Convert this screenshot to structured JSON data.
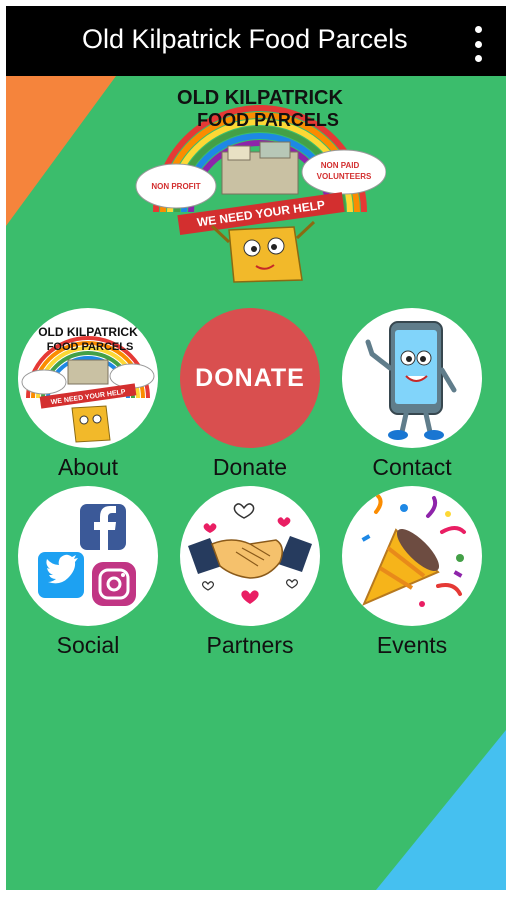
{
  "appbar": {
    "title": "Old Kilpatrick Food Parcels",
    "menu_icon": "overflow-menu-icon"
  },
  "logo": {
    "title_line1": "OLD KILPATRICK",
    "title_line2": "FOOD PARCELS",
    "non_profit": "NON PROFIT",
    "non_paid_line1": "NON PAID",
    "non_paid_line2": "VOLUNTEERS",
    "banner": "WE NEED YOUR HELP"
  },
  "tiles": [
    {
      "label": "About",
      "icon": "food-parcels-logo-icon"
    },
    {
      "label": "Donate",
      "icon": "donate-icon",
      "badge_text": "DONATE"
    },
    {
      "label": "Contact",
      "icon": "phone-mascot-icon"
    },
    {
      "label": "Social",
      "icon": "social-media-icon"
    },
    {
      "label": "Partners",
      "icon": "handshake-icon"
    },
    {
      "label": "Events",
      "icon": "party-popper-icon"
    }
  ],
  "colors": {
    "background": "#3bbd6c",
    "appbar": "#000000",
    "corner_orange": "#f5843c",
    "corner_blue": "#45c0f0",
    "donate_red": "#d94f4f"
  }
}
